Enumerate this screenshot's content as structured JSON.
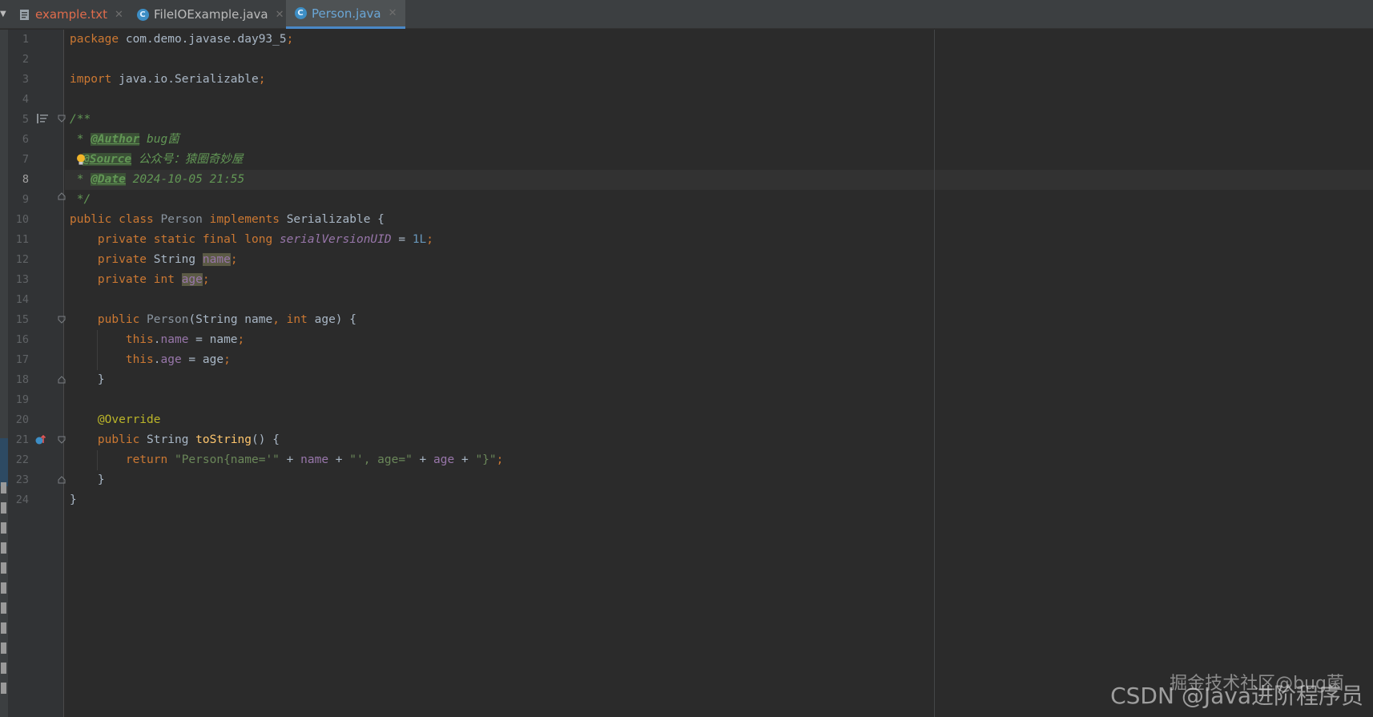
{
  "tabs": [
    {
      "label": "example.txt",
      "icon": "text-file-icon",
      "color": "#e06c4c",
      "active": false
    },
    {
      "label": "FileIOExample.java",
      "icon": "java-class-icon",
      "color": "#bbbbbb",
      "active": false
    },
    {
      "label": "Person.java",
      "icon": "java-class-icon",
      "color": "#6aa6d6",
      "active": true
    }
  ],
  "colors": {
    "background": "#2b2b2b",
    "keyword": "#cc7832",
    "string": "#6a8759",
    "number": "#6897bb",
    "field": "#9876aa",
    "annotation": "#bbb529",
    "doc_comment": "#629755",
    "method": "#ffc66d",
    "active_tab_underline": "#4a88c7"
  },
  "editor": {
    "current_line": 8,
    "line_numbers": [
      "1",
      "2",
      "3",
      "4",
      "5",
      "6",
      "7",
      "8",
      "9",
      "10",
      "11",
      "12",
      "13",
      "14",
      "15",
      "16",
      "17",
      "18",
      "19",
      "20",
      "21",
      "22",
      "23",
      "24"
    ],
    "code": {
      "l1_kw": "package",
      "l1_rest": " com.demo.javase.day93_5",
      "semi": ";",
      "l3_kw": "import",
      "l3_rest": " java.io.Serializable",
      "l5": "/**",
      "l6_star": " * ",
      "l6_tag": "@Author",
      "l6_text": " bug菌",
      "l7_tag": "@Source",
      "l7_text": " 公众号：猿圈奇妙屋",
      "l8_star": " * ",
      "l8_tag": "@Date",
      "l8_text": " 2024-10-05 21:55",
      "l9": " */",
      "public": "public",
      "class": "class",
      "l10_name": "Person",
      "implements": "implements",
      "l10_iface": "Serializable",
      "open_brace": " {",
      "close_brace": "}",
      "private": "private",
      "static": "static",
      "final": "final",
      "long": "long",
      "serial_field": "serialVersionUID",
      "eq": " = ",
      "serial_value": "1L",
      "string_type": "String",
      "field_name": "name",
      "int": "int",
      "field_age": "age",
      "ctor_name": "Person",
      "ctor_params_a": "(String name",
      "comma": ", ",
      "ctor_params_b": " age)",
      "this": "this",
      "dot": ".",
      "assign_name": " = name",
      "assign_age": " = age",
      "override": "@Override",
      "tostring": "toString",
      "parens": "()",
      "return": "return",
      "str1": "\"Person{name='\"",
      "plus": " + ",
      "str2": "\"', age=\"",
      "str3": "\"}\""
    }
  },
  "watermark": {
    "text": "CSDN @Java进阶程序员",
    "overlay": "掘金技术社区@bug菌"
  }
}
